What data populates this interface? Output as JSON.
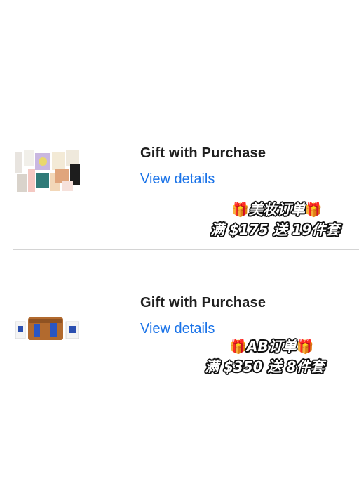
{
  "items": [
    {
      "title": "Gift with Purchase",
      "details_link": "View details",
      "promo_line1_prefix": "🎁",
      "promo_line1_text": "美妆订单",
      "promo_line1_suffix": "🎁",
      "promo_line2": "满 $175 送 19件套"
    },
    {
      "title": "Gift with Purchase",
      "details_link": "View details",
      "promo_line1_prefix": "🎁",
      "promo_line1_text": "AB订单",
      "promo_line1_suffix": "🎁",
      "promo_line2": "满 $350 送 8件套"
    }
  ]
}
